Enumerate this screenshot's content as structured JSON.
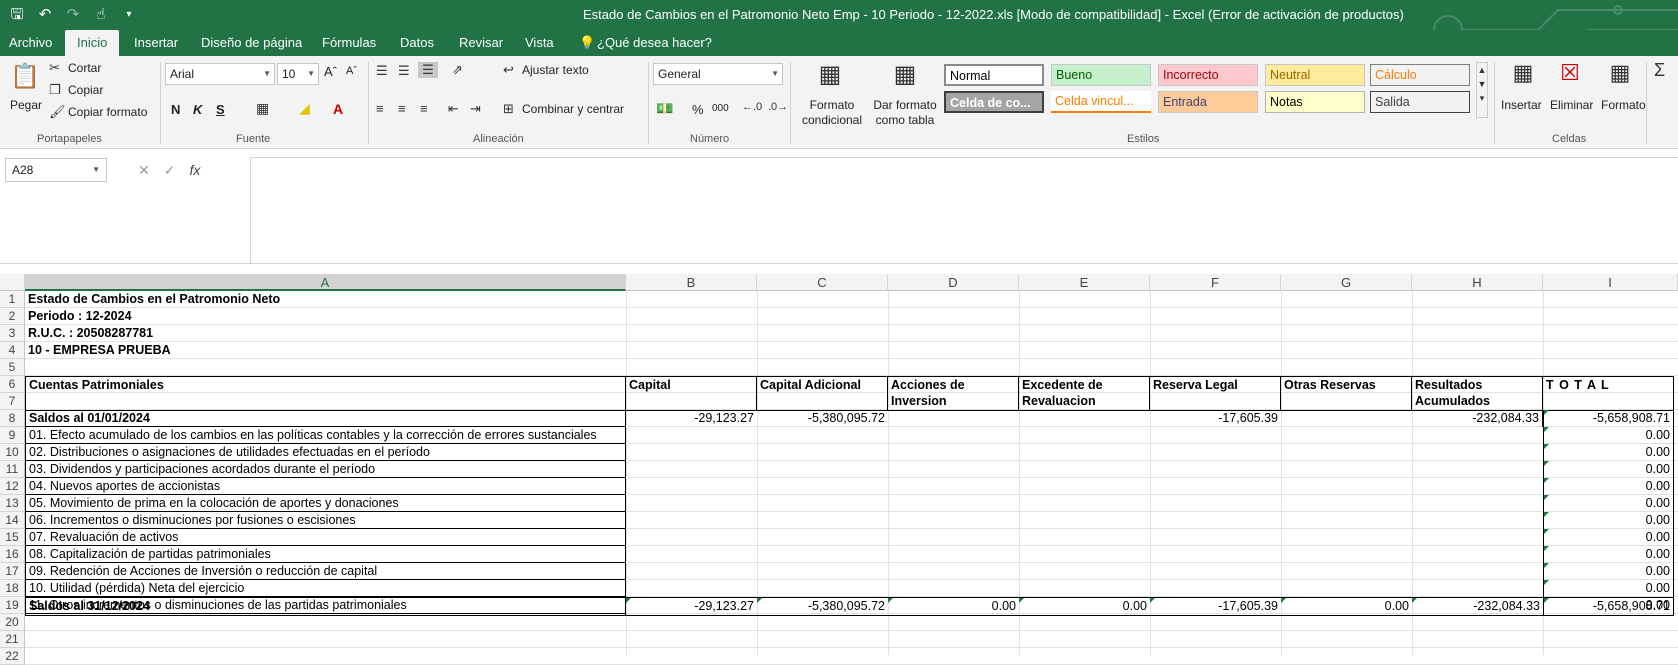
{
  "window": {
    "title": "Estado de Cambios en el Patromonio Neto Emp - 10 Periodo - 12-2022.xls  [Modo de compatibilidad] - Excel (Error de activación de productos)"
  },
  "tabs": [
    {
      "label": "Archivo"
    },
    {
      "label": "Inicio"
    },
    {
      "label": "Insertar"
    },
    {
      "label": "Diseño de página"
    },
    {
      "label": "Fórmulas"
    },
    {
      "label": "Datos"
    },
    {
      "label": "Revisar"
    },
    {
      "label": "Vista"
    },
    {
      "label": "¿Qué desea hacer?"
    }
  ],
  "ribbon": {
    "clipboard": {
      "paste": "Pegar",
      "cut": "Cortar",
      "copy": "Copiar",
      "format_painter": "Copiar formato",
      "label": "Portapapeles"
    },
    "font": {
      "name": "Arial",
      "size": "10",
      "bold": "N",
      "italic": "K",
      "underline": "S",
      "label": "Fuente"
    },
    "alignment": {
      "wrap": "Ajustar texto",
      "merge": "Combinar y centrar",
      "label": "Alineación"
    },
    "number": {
      "format": "General",
      "percent": "%",
      "thousands": "000",
      "label": "Número"
    },
    "styles": {
      "conditional": [
        "Formato",
        "condicional"
      ],
      "as_table": [
        "Dar formato",
        "como tabla"
      ],
      "label": "Estilos",
      "cells": [
        {
          "text": "Normal",
          "bg": "#ffffff",
          "fg": "#000000"
        },
        {
          "text": "Bueno",
          "bg": "#c6efce",
          "fg": "#006100"
        },
        {
          "text": "Incorrecto",
          "bg": "#ffc7ce",
          "fg": "#9c0006"
        },
        {
          "text": "Neutral",
          "bg": "#ffeb9c",
          "fg": "#9c6500"
        },
        {
          "text": "Cálculo",
          "bg": "#f2f2f2",
          "fg": "#fa7d00"
        },
        {
          "text": "Celda de co...",
          "bg": "#a5a5a5",
          "fg": "#ffffff"
        },
        {
          "text": "Celda vincul...",
          "bg": "#ffffff",
          "fg": "#fa7d00"
        },
        {
          "text": "Entrada",
          "bg": "#ffcc99",
          "fg": "#3f3f76"
        },
        {
          "text": "Notas",
          "bg": "#ffffcc",
          "fg": "#000000"
        },
        {
          "text": "Salida",
          "bg": "#f2f2f2",
          "fg": "#3f3f3f"
        }
      ]
    },
    "cells_group": {
      "insert": "Insertar",
      "delete": "Eliminar",
      "format": "Formato",
      "label": "Celdas"
    }
  },
  "formula_bar": {
    "name_box": "A28",
    "fx": "fx",
    "value": ""
  },
  "columns": [
    "A",
    "B",
    "C",
    "D",
    "E",
    "F",
    "G",
    "H",
    "I"
  ],
  "rows": [
    "1",
    "2",
    "3",
    "4",
    "5",
    "6",
    "7",
    "8",
    "9",
    "10",
    "11",
    "12",
    "13",
    "14",
    "15",
    "16",
    "17",
    "18",
    "19",
    "20",
    "21",
    "22"
  ],
  "sheet": {
    "r1": "Estado de Cambios en el Patromonio Neto",
    "r2": "Periodo : 12-2024",
    "r3": "R.U.C. : 20508287781",
    "r4": "10 - EMPRESA PRUEBA",
    "headers": {
      "a": "Cuentas Patrimoniales",
      "b": "Capital",
      "c": "Capital Adicional",
      "d1": "Acciones de",
      "d2": "Inversion",
      "e1": "Excedente de",
      "e2": "Revaluacion",
      "f": "Reserva Legal",
      "g": "Otras Reservas",
      "h1": "Resultados",
      "h2": "Acumulados",
      "i": "T O T A L"
    },
    "opening": {
      "label": "Saldos al 01/01/2024",
      "b": "-29,123.27",
      "c": "-5,380,095.72",
      "f": "-17,605.39",
      "h": "-232,084.33",
      "i": "-5,658,908.71"
    },
    "items": [
      {
        "label": "01. Efecto acumulado de los cambios en las políticas contables y la corrección de errores sustanciales",
        "total": "0.00"
      },
      {
        "label": "02. Distribuciones o asignaciones de utilidades efectuadas en el período",
        "total": "0.00"
      },
      {
        "label": "03. Dividendos y participaciones acordados durante el período",
        "total": "0.00"
      },
      {
        "label": "04. Nuevos aportes de accionistas",
        "total": "0.00"
      },
      {
        "label": "05. Movimiento de prima en la colocación de aportes y donaciones",
        "total": "0.00"
      },
      {
        "label": "06. Incrementos o disminuciones por fusiones o escisiones",
        "total": "0.00"
      },
      {
        "label": "07. Revaluación de activos",
        "total": "0.00"
      },
      {
        "label": "08. Capitalización de partidas patrimoniales",
        "total": "0.00"
      },
      {
        "label": "09. Redención de Acciones de Inversión o reducción de capital",
        "total": "0.00"
      },
      {
        "label": "10. Utilidad (pérdida) Neta del ejercicio",
        "total": "0.00"
      },
      {
        "label": "11. Otros incrementos o disminuciones de las partidas patrimoniales",
        "total": "0.00"
      }
    ],
    "closing": {
      "label": "Saldos al 31/12/2024",
      "b": "-29,123.27",
      "c": "-5,380,095.72",
      "d": "0.00",
      "e": "0.00",
      "f": "-17,605.39",
      "g": "0.00",
      "h": "-232,084.33",
      "i": "-5,658,908.71"
    }
  }
}
